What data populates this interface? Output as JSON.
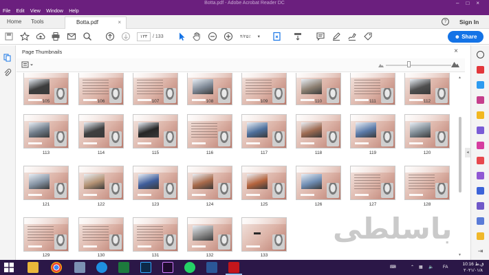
{
  "app": {
    "title": "Botta.pdf - Adobe Acrobat Reader DC",
    "menu": [
      "File",
      "Edit",
      "View",
      "Window",
      "Help"
    ]
  },
  "tabs": {
    "home": "Home",
    "tools": "Tools",
    "document": "Botta.pdf",
    "close_glyph": "×"
  },
  "header": {
    "help_glyph": "?",
    "sign_in": "Sign In"
  },
  "toolbar": {
    "page_current": "۱۳۳",
    "page_separator": "/",
    "page_total": "133",
    "zoom_value": "۴/۲۵٪",
    "share_label": "Share"
  },
  "panel": {
    "title": "Page Thumbnails",
    "close_glyph": "×"
  },
  "thumbnails": [
    {
      "page": "105",
      "kind": "photo",
      "tone": "#3c3c3c"
    },
    {
      "page": "106",
      "kind": "text",
      "tone": "#6a5a50"
    },
    {
      "page": "107",
      "kind": "text",
      "tone": "#6a5a50"
    },
    {
      "page": "108",
      "kind": "photo",
      "tone": "#7d8794"
    },
    {
      "page": "109",
      "kind": "text",
      "tone": "#6a5a50"
    },
    {
      "page": "110",
      "kind": "photo",
      "tone": "#8c7f71"
    },
    {
      "page": "111",
      "kind": "text",
      "tone": "#6a5a50"
    },
    {
      "page": "112",
      "kind": "photo",
      "tone": "#4f4f4f"
    },
    {
      "page": "113",
      "kind": "photo",
      "tone": "#6f7b88"
    },
    {
      "page": "114",
      "kind": "photo",
      "tone": "#3f3f3f"
    },
    {
      "page": "115",
      "kind": "photo",
      "tone": "#262626"
    },
    {
      "page": "116",
      "kind": "text",
      "tone": "#6a5a50"
    },
    {
      "page": "117",
      "kind": "photo",
      "tone": "#4e6f9b"
    },
    {
      "page": "118",
      "kind": "photo",
      "tone": "#9e6b52"
    },
    {
      "page": "119",
      "kind": "photo",
      "tone": "#5b7aa8"
    },
    {
      "page": "120",
      "kind": "photo",
      "tone": "#7e8a93"
    },
    {
      "page": "121",
      "kind": "photo",
      "tone": "#8593a3"
    },
    {
      "page": "122",
      "kind": "photo",
      "tone": "#b49274"
    },
    {
      "page": "123",
      "kind": "photo",
      "tone": "#3f5d9a"
    },
    {
      "page": "124",
      "kind": "photo",
      "tone": "#a86a4a"
    },
    {
      "page": "125",
      "kind": "photo",
      "tone": "#b5643d"
    },
    {
      "page": "126",
      "kind": "photo",
      "tone": "#6f8db3"
    },
    {
      "page": "127",
      "kind": "text",
      "tone": "#6a5a50"
    },
    {
      "page": "128",
      "kind": "text",
      "tone": "#6a5a50"
    },
    {
      "page": "129",
      "kind": "text",
      "tone": "#6a5a50"
    },
    {
      "page": "130",
      "kind": "text",
      "tone": "#6a5a50"
    },
    {
      "page": "131",
      "kind": "text",
      "tone": "#6a5a50"
    },
    {
      "page": "132",
      "kind": "photo",
      "tone": "#8b8b8b"
    },
    {
      "page": "133",
      "kind": "title",
      "tone": "#2a2a2a"
    }
  ],
  "watermark": "باسلطی",
  "taskbar": {
    "lang": "FA",
    "time": "10:16 ق.ظ",
    "date": "۲۰۲۱/۰۱/۸"
  },
  "colors": {
    "accent": "#1473e6",
    "titlebar": "#6b1f7e",
    "taskbar": "#2b1747"
  }
}
